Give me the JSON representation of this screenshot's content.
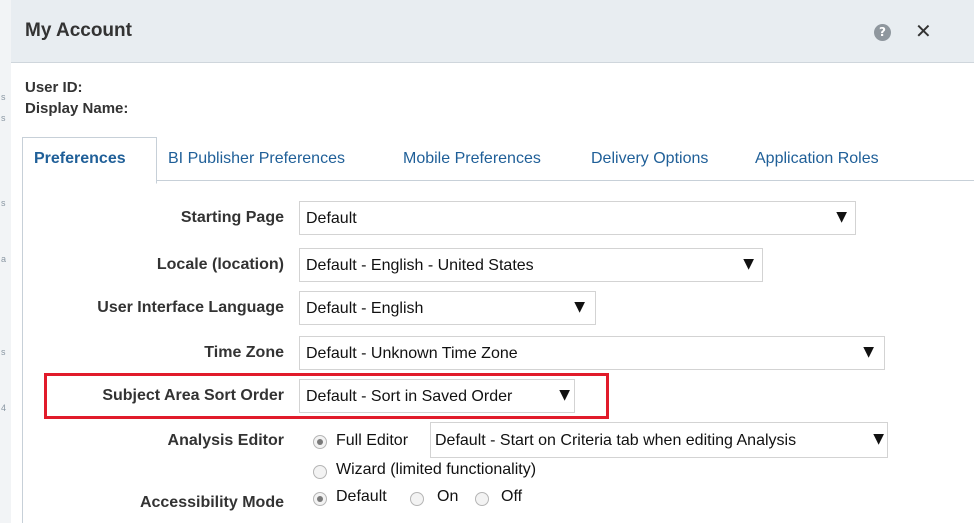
{
  "dialog": {
    "title": "My Account",
    "help_icon": "help-icon",
    "close_icon": "close-icon"
  },
  "account": {
    "user_id_label": "User ID:",
    "display_name_label": "Display Name:"
  },
  "tabs": [
    {
      "label": "Preferences",
      "active": true
    },
    {
      "label": "BI Publisher Preferences",
      "active": false
    },
    {
      "label": "Mobile Preferences",
      "active": false
    },
    {
      "label": "Delivery Options",
      "active": false
    },
    {
      "label": "Application Roles",
      "active": false
    }
  ],
  "preferences": {
    "starting_page": {
      "label": "Starting Page",
      "value": "Default"
    },
    "locale": {
      "label": "Locale (location)",
      "value": "Default - English - United States"
    },
    "ui_language": {
      "label": "User Interface Language",
      "value": "Default - English"
    },
    "time_zone": {
      "label": "Time Zone",
      "value": "Default - Unknown Time Zone"
    },
    "sort_order": {
      "label": "Subject Area Sort Order",
      "value": "Default - Sort in Saved Order"
    },
    "analysis_editor": {
      "label": "Analysis Editor",
      "option_full": "Full Editor",
      "option_wizard": "Wizard (limited functionality)",
      "selected": "Full Editor",
      "full_editor_select": "Default - Start on Criteria tab when editing Analysis"
    },
    "accessibility": {
      "label": "Accessibility Mode",
      "option_default": "Default",
      "option_on": "On",
      "option_off": "Off",
      "selected": "Default"
    }
  },
  "colors": {
    "highlight": "#e11b2a",
    "tab_link": "#1f5f98",
    "titlebar": "#e8edf1"
  }
}
